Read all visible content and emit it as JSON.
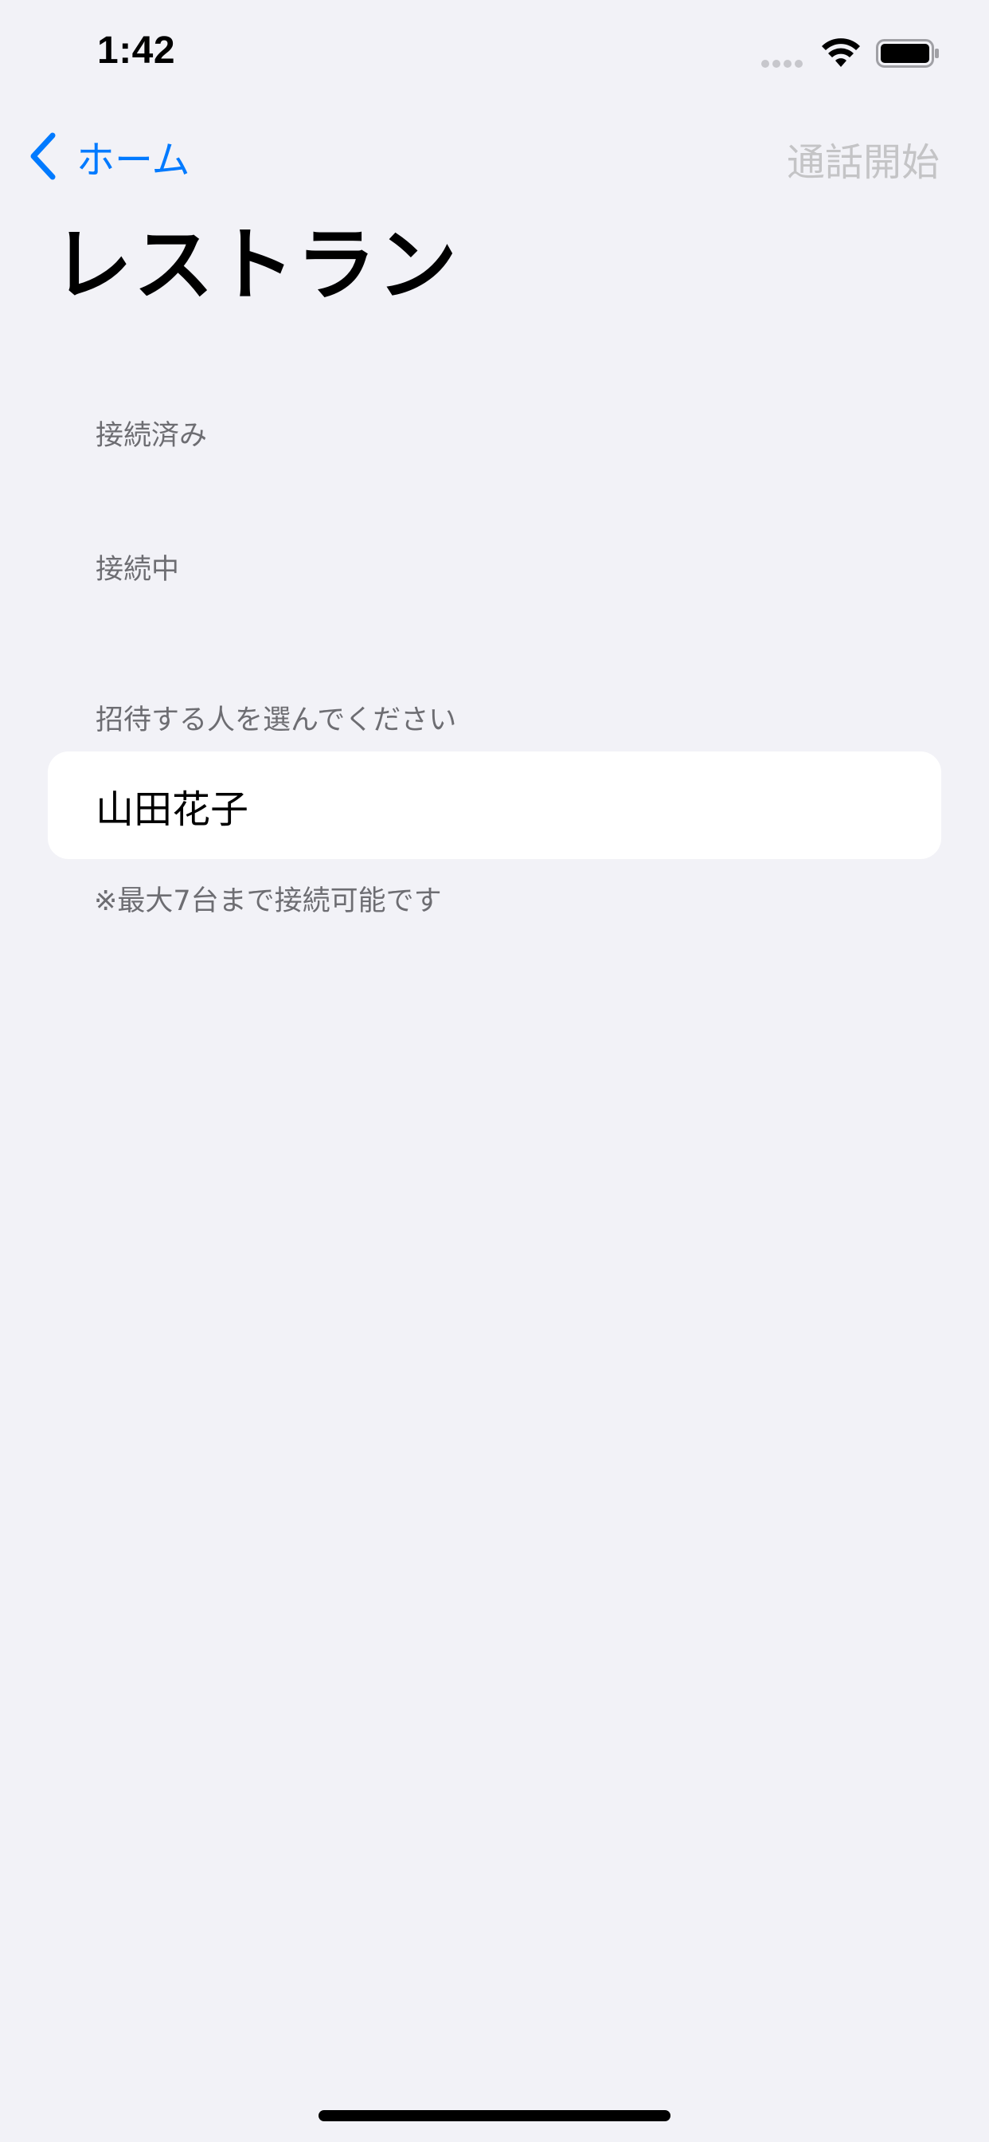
{
  "status_bar": {
    "time": "1:42",
    "icons": [
      "cellular-signal-icon",
      "wifi-icon",
      "battery-icon"
    ]
  },
  "nav": {
    "back_label": "ホーム",
    "back_icon": "chevron-left-icon",
    "action_label": "通話開始",
    "action_enabled": false
  },
  "title": "レストラン",
  "sections": {
    "connected_header": "接続済み",
    "connecting_header": "接続中",
    "invite_header": "招待する人を選んでください",
    "invite_footer": "※最大7台まで接続可能です"
  },
  "contacts": [
    {
      "name": "山田花子"
    }
  ],
  "colors": {
    "background": "#f2f2f7",
    "accent": "#007aff",
    "disabled": "#c4c4c6",
    "secondary_text": "#6d6d72"
  }
}
